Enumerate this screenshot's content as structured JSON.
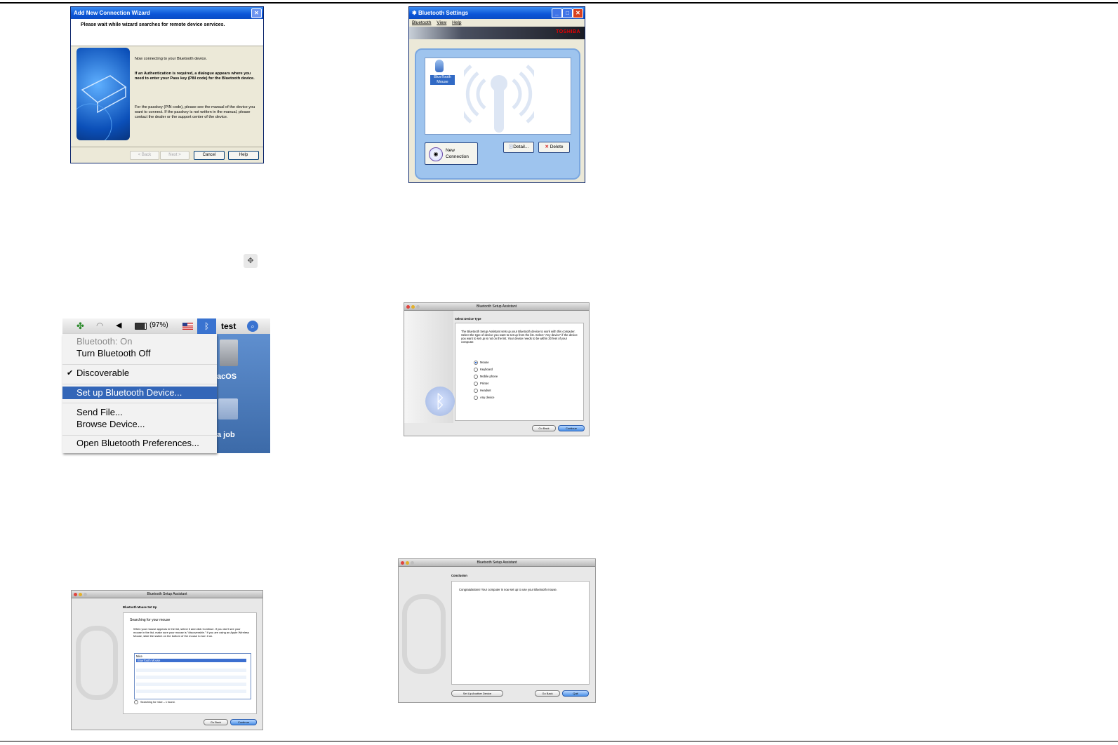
{
  "wizard": {
    "title": "Add New Connection Wizard",
    "heading": "Please wait while wizard searches for remote device services.",
    "text1": "Now connecting to your Bluetooth device.",
    "text2": "If an Authentication is required, a dialogue appears where you need to enter your Pass key (PIN code) for the Bluetooth device.",
    "text3": "For the passkey (PIN code), please see the manual of the device you want to connect. If the passkey is not written in the manual, please contact the dealer or the support center of the device.",
    "back": "< Back",
    "next": "Next >",
    "cancel": "Cancel",
    "help": "Help"
  },
  "bt_settings": {
    "title": "Bluetooth Settings",
    "menu": [
      "Bluetooth",
      "View",
      "Help"
    ],
    "brand": "TOSHIBA",
    "device_label": "BlueTooth Mouse",
    "new_connection": "New Connection",
    "detail": "Detail...",
    "delete": "Delete"
  },
  "mac_menu": {
    "battery": "(97%)",
    "user": "test",
    "items": {
      "status": "Bluetooth: On",
      "turn_off": "Turn Bluetooth Off",
      "discoverable": "Discoverable",
      "setup": "Set up Bluetooth Device...",
      "send": "Send File...",
      "browse": "Browse Device...",
      "prefs": "Open Bluetooth Preferences..."
    },
    "desktop_label1": "acOS",
    "desktop_label2": "a job"
  },
  "device_type": {
    "title": "Bluetooth Setup Assistant",
    "heading": "Select Device Type",
    "description": "The Bluetooth Setup Assistant sets up your Bluetooth device to work with this computer. Select the type of device you want to set up from the list. Select \"Any device\" if the device you want to set up is not on the list. Your device needs to be within 30 feet of your computer.",
    "options": [
      "Mouse",
      "Keyboard",
      "Mobile phone",
      "Printer",
      "Headset",
      "Any device"
    ],
    "selected": "Mouse",
    "go_back": "Go Back",
    "continue": "Continue"
  },
  "mouse_setup": {
    "title": "Bluetooth Setup Assistant",
    "heading": "Bluetooth Mouse Set Up",
    "subheading": "Searching for your mouse",
    "description": "When your mouse appears in the list, select it and click Continue. If you don't see your mouse in the list, make sure your mouse is \"discoverable.\" If you are using an Apple Wireless Mouse, slide the switch on the bottom of the mouse to turn it on.",
    "list_header": "Mice",
    "list_item": "BlueTooth Mouse",
    "status": "Searching for mice – 1 found.",
    "go_back": "Go Back",
    "continue": "Continue"
  },
  "conclusion": {
    "title": "Bluetooth Setup Assistant",
    "heading": "Conclusion",
    "message": "Congratulations! Your computer is now set up to use your Bluetooth mouse.",
    "another": "Set Up Another Device",
    "go_back": "Go Back",
    "quit": "Quit"
  }
}
